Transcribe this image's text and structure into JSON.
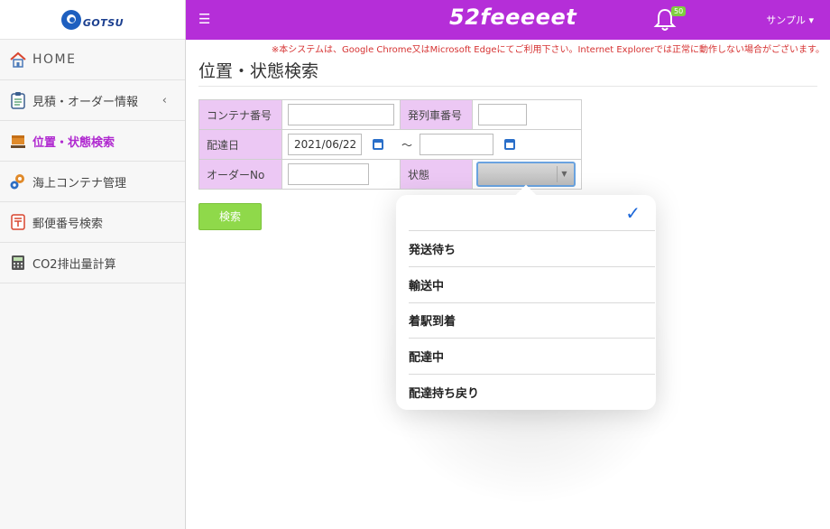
{
  "app": {
    "brand": "52feeeeet",
    "notification_count": "50",
    "user_menu": "サンプル ▾",
    "logo_text": "GOTSU"
  },
  "notice": "※本システムは、Google Chrome又はMicrosoft Edgeにてご利用下さい。Internet Explorerでは正常に動作しない場合がございます。",
  "sidebar": {
    "items": [
      {
        "label": "HOME",
        "icon": "home-icon"
      },
      {
        "label": "見積・オーダー情報",
        "icon": "clipboard-icon"
      },
      {
        "label": "位置・状態検索",
        "icon": "package-icon"
      },
      {
        "label": "海上コンテナ管理",
        "icon": "gears-icon"
      },
      {
        "label": "郵便番号検索",
        "icon": "postal-icon"
      },
      {
        "label": "CO2排出量計算",
        "icon": "calculator-icon"
      }
    ]
  },
  "page": {
    "title": "位置・状態検索"
  },
  "form": {
    "container_no_label": "コンテナ番号",
    "container_no_value": "",
    "train_no_label": "発列車番号",
    "train_no_value": "",
    "delivery_date_label": "配達日",
    "delivery_date_from": "2021/06/22",
    "delivery_date_to": "",
    "range_sep": "～",
    "order_no_label": "オーダーNo",
    "order_no_value": "",
    "status_label": "状態",
    "status_value": "",
    "search_button": "検索"
  },
  "dropdown": {
    "options": [
      "",
      "発送待ち",
      "輸送中",
      "着駅到着",
      "配達中",
      "配達持ち戻り"
    ],
    "selected_index": 0
  },
  "colors": {
    "header": "#b52ed8",
    "label_bg": "#ecc8f4",
    "search_button": "#8fd94a",
    "active_nav": "#b02ad0",
    "notice": "#d63333",
    "check": "#1a66d9"
  }
}
